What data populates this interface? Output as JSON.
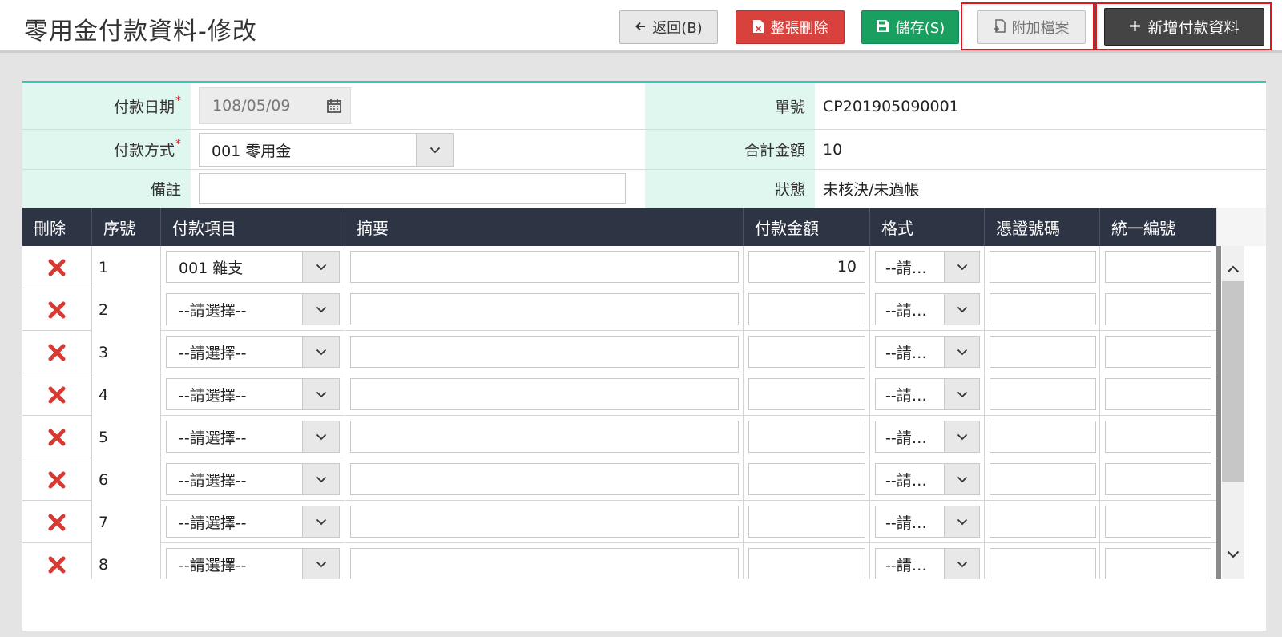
{
  "header": {
    "title": "零用金付款資料-修改",
    "buttons": {
      "back": "返回(B)",
      "delete_all": "整張刪除",
      "save": "儲存(S)",
      "attach": "附加檔案",
      "add": "新增付款資料"
    }
  },
  "form": {
    "date_label": "付款日期",
    "date_value": "108/05/09",
    "method_label": "付款方式",
    "method_value": "001 零用金",
    "note_label": "備註",
    "note_value": "",
    "no_label": "單號",
    "no_value": "CP201905090001",
    "total_label": "合計金額",
    "total_value": "10",
    "status_label": "狀態",
    "status_value": "未核決/未過帳",
    "required_mark": "*"
  },
  "table": {
    "headers": [
      "刪除",
      "序號",
      "付款項目",
      "摘要",
      "付款金額",
      "格式",
      "憑證號碼",
      "統一編號"
    ],
    "rows": [
      {
        "no": "1",
        "item": "001 雜支",
        "summary": "",
        "amount": "10",
        "format": "--請…",
        "voucher": "",
        "unified": ""
      },
      {
        "no": "2",
        "item": "--請選擇--",
        "summary": "",
        "amount": "",
        "format": "--請…",
        "voucher": "",
        "unified": ""
      },
      {
        "no": "3",
        "item": "--請選擇--",
        "summary": "",
        "amount": "",
        "format": "--請…",
        "voucher": "",
        "unified": ""
      },
      {
        "no": "4",
        "item": "--請選擇--",
        "summary": "",
        "amount": "",
        "format": "--請…",
        "voucher": "",
        "unified": ""
      },
      {
        "no": "5",
        "item": "--請選擇--",
        "summary": "",
        "amount": "",
        "format": "--請…",
        "voucher": "",
        "unified": ""
      },
      {
        "no": "6",
        "item": "--請選擇--",
        "summary": "",
        "amount": "",
        "format": "--請…",
        "voucher": "",
        "unified": ""
      },
      {
        "no": "7",
        "item": "--請選擇--",
        "summary": "",
        "amount": "",
        "format": "--請…",
        "voucher": "",
        "unified": ""
      },
      {
        "no": "8",
        "item": "--請選擇--",
        "summary": "",
        "amount": "",
        "format": "--請…",
        "voucher": "",
        "unified": ""
      }
    ]
  },
  "colors": {
    "accent_teal": "#2fc8b2",
    "label_bg": "#e0f7ef",
    "danger": "#d9413c",
    "success": "#19a060",
    "header_dark": "#2d3443",
    "highlight": "#e4141e"
  },
  "icons": {
    "back": "arrow-left-icon",
    "delete_all": "file-delete-icon",
    "save": "floppy-icon",
    "attach": "file-attach-icon",
    "add": "plus-icon",
    "calendar": "calendar-icon",
    "dropdown": "chevron-down-icon",
    "row_delete": "x-icon"
  }
}
